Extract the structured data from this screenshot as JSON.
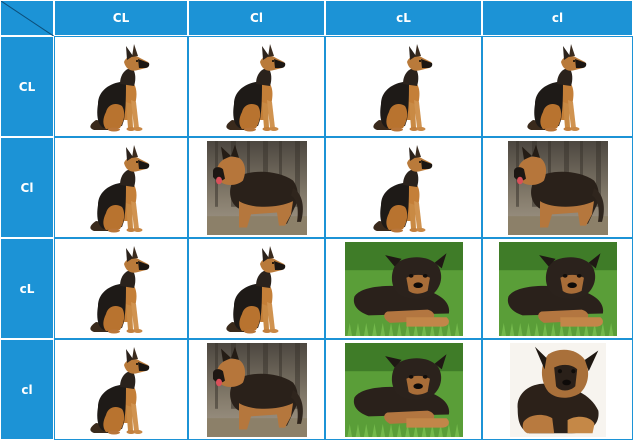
{
  "headers": {
    "columns": [
      "CL",
      "Cl",
      "cL",
      "cl"
    ],
    "rows": [
      "CL",
      "Cl",
      "cL",
      "cl"
    ]
  },
  "matrix": [
    [
      "sitting-shepherd-icon",
      "sitting-shepherd-icon",
      "sitting-shepherd-icon",
      "sitting-shepherd-icon"
    ],
    [
      "sitting-shepherd-icon",
      "longhaired-shepherd-photo",
      "sitting-shepherd-icon",
      "longhaired-shepherd-photo"
    ],
    [
      "sitting-shepherd-icon",
      "sitting-shepherd-icon",
      "shepherd-puppy-on-grass-photo",
      "shepherd-puppy-on-grass-photo"
    ],
    [
      "sitting-shepherd-icon",
      "longhaired-shepherd-photo",
      "shepherd-puppy-on-grass-photo",
      "fluffy-shepherd-puppy-photo"
    ]
  ],
  "colors": {
    "header_bg": "#1c93d6",
    "header_text": "#ffffff",
    "cell_border": "#1c93d6",
    "corner_diagonal": "#0d4f7a"
  }
}
